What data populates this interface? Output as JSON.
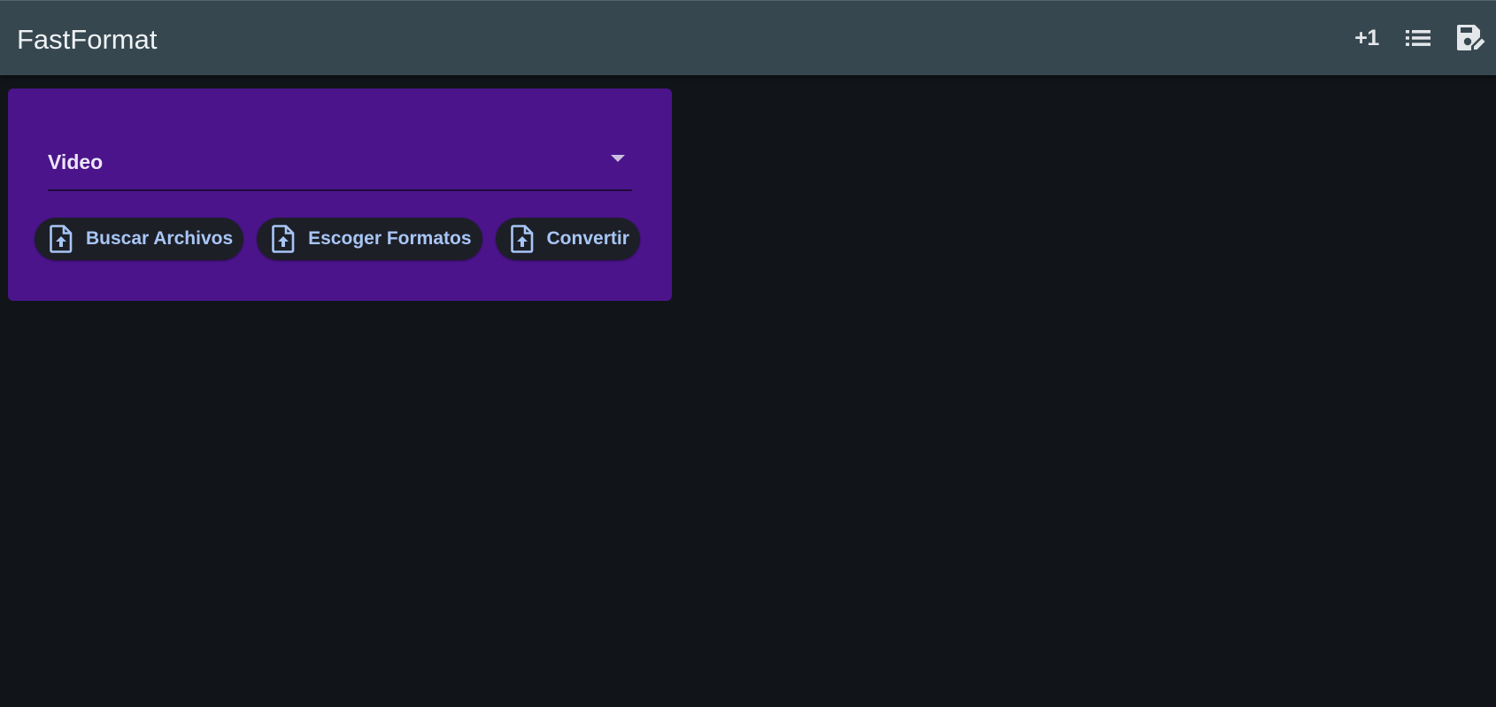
{
  "app_bar": {
    "title": "FastFormat",
    "actions": [
      {
        "label": "+1",
        "icon": "plus-one-icon"
      },
      {
        "icon": "list-icon"
      },
      {
        "icon": "save-edit-icon"
      }
    ]
  },
  "card": {
    "select": {
      "value": "Video"
    },
    "buttons": [
      {
        "label": "Buscar Archivos",
        "icon": "file-upload-icon"
      },
      {
        "label": "Escoger Formatos",
        "icon": "file-upload-icon"
      },
      {
        "label": "Convertir",
        "icon": "file-upload-icon"
      }
    ]
  },
  "colors": {
    "app_bar": "#37474f",
    "background": "#11151a",
    "card": "#4b148b",
    "chip": "#1d1f27",
    "chip_text": "#a8c6f5"
  }
}
